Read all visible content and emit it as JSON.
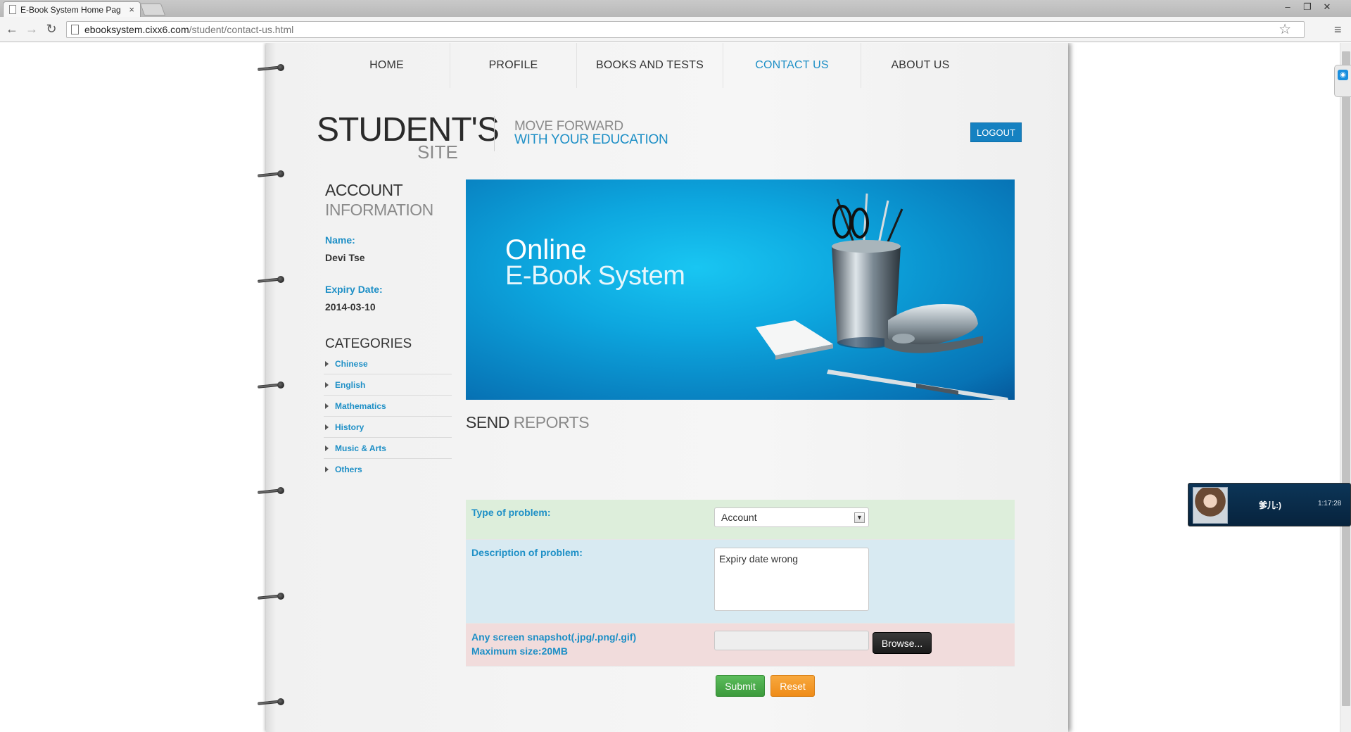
{
  "browser": {
    "tab_title": "E-Book System Home Pag",
    "tab_close": "×",
    "url_host": "ebooksystem.cixx6.com",
    "url_path": "/student/contact-us.html",
    "back_icon": "←",
    "forward_icon": "→",
    "reload_icon": "↻",
    "star_icon": "☆",
    "menu_icon": "≡",
    "min_icon": "–",
    "restore_icon": "❐",
    "close_icon": "✕"
  },
  "nav": {
    "items": [
      {
        "label": "HOME"
      },
      {
        "label": "PROFILE"
      },
      {
        "label": "BOOKS AND TESTS"
      },
      {
        "label": "CONTACT US"
      },
      {
        "label": "ABOUT US"
      }
    ],
    "active_color": "#1d8fc6"
  },
  "header": {
    "brand": "STUDENT'S",
    "brand_sub": "SITE",
    "tagline_1": "MOVE FORWARD",
    "tagline_2": "WITH YOUR EDUCATION",
    "logout": "LOGOUT"
  },
  "sidebar": {
    "heading_1": "ACCOUNT",
    "heading_2": "INFORMATION",
    "name_label": "Name:",
    "name_value": "Devi Tse",
    "expiry_label": "Expiry Date:",
    "expiry_value": "2014-03-10",
    "categories_heading": "CATEGORIES",
    "categories": [
      {
        "label": "Chinese"
      },
      {
        "label": "English"
      },
      {
        "label": "Mathematics"
      },
      {
        "label": "History"
      },
      {
        "label": "Music & Arts"
      },
      {
        "label": "Others"
      }
    ]
  },
  "banner": {
    "line_1": "Online",
    "line_2": "E-Book System"
  },
  "form": {
    "heading_1": "SEND",
    "heading_2": "REPORTS",
    "type_label": "Type of problem:",
    "type_value": "Account",
    "description_label": "Description of problem:",
    "description_value": "Expiry date wrong",
    "snapshot_label_1": "Any screen snapshot(.jpg/.png/.gif)",
    "snapshot_label_2": "Maximum size:20MB",
    "browse_label": "Browse...",
    "submit_label": "Submit",
    "reset_label": "Reset"
  },
  "chat_popup": {
    "name": "爹儿:)",
    "time": "1:17:28"
  }
}
